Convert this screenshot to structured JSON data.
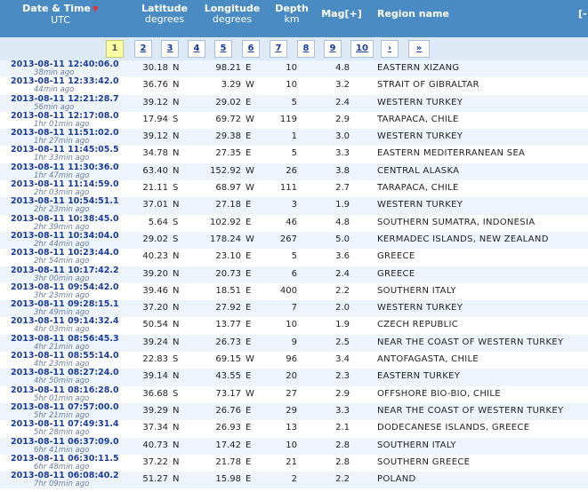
{
  "header": {
    "datetime_label": "Date & Time",
    "datetime_sub": "UTC",
    "sort_icon": "▼",
    "lat_label": "Latitude",
    "lat_sub": "degrees",
    "lon_label": "Longitude",
    "lon_sub": "degrees",
    "depth_label": "Depth",
    "depth_sub": "km",
    "mag_label": "Mag[+]",
    "region_label": "Region name",
    "extra_label": "[-"
  },
  "pagination": {
    "pages": [
      "1",
      "2",
      "3",
      "4",
      "5",
      "6",
      "7",
      "8",
      "9",
      "10",
      "›",
      "»"
    ],
    "current": "1"
  },
  "rows": [
    {
      "datetime": "2013-08-11 12:40:06.0",
      "ago": "38min ago",
      "lat": "30.18",
      "ns": "N",
      "lon": "98.21",
      "ew": "E",
      "depth": "10",
      "mag": "4.8",
      "region": "EASTERN XIZANG"
    },
    {
      "datetime": "2013-08-11 12:33:42.0",
      "ago": "44min ago",
      "lat": "36.76",
      "ns": "N",
      "lon": "3.29",
      "ew": "W",
      "depth": "10",
      "mag": "3.2",
      "region": "STRAIT OF GIBRALTAR"
    },
    {
      "datetime": "2013-08-11 12:21:28.7",
      "ago": "56min ago",
      "lat": "39.12",
      "ns": "N",
      "lon": "29.02",
      "ew": "E",
      "depth": "5",
      "mag": "2.4",
      "region": "WESTERN TURKEY"
    },
    {
      "datetime": "2013-08-11 12:17:08.0",
      "ago": "1hr 01min ago",
      "lat": "17.94",
      "ns": "S",
      "lon": "69.72",
      "ew": "W",
      "depth": "119",
      "mag": "2.9",
      "region": "TARAPACA, CHILE"
    },
    {
      "datetime": "2013-08-11 11:51:02.0",
      "ago": "1hr 27min ago",
      "lat": "39.12",
      "ns": "N",
      "lon": "29.38",
      "ew": "E",
      "depth": "1",
      "mag": "3.0",
      "region": "WESTERN TURKEY"
    },
    {
      "datetime": "2013-08-11 11:45:05.5",
      "ago": "1hr 33min ago",
      "lat": "34.78",
      "ns": "N",
      "lon": "27.35",
      "ew": "E",
      "depth": "5",
      "mag": "3.3",
      "region": "EASTERN MEDITERRANEAN SEA"
    },
    {
      "datetime": "2013-08-11 11:30:36.0",
      "ago": "1hr 47min ago",
      "lat": "63.40",
      "ns": "N",
      "lon": "152.92",
      "ew": "W",
      "depth": "26",
      "mag": "3.8",
      "region": "CENTRAL ALASKA"
    },
    {
      "datetime": "2013-08-11 11:14:59.0",
      "ago": "2hr 03min ago",
      "lat": "21.11",
      "ns": "S",
      "lon": "68.97",
      "ew": "W",
      "depth": "111",
      "mag": "2.7",
      "region": "TARAPACA, CHILE"
    },
    {
      "datetime": "2013-08-11 10:54:51.1",
      "ago": "2hr 23min ago",
      "lat": "37.01",
      "ns": "N",
      "lon": "27.18",
      "ew": "E",
      "depth": "3",
      "mag": "1.9",
      "region": "WESTERN TURKEY"
    },
    {
      "datetime": "2013-08-11 10:38:45.0",
      "ago": "2hr 39min ago",
      "lat": "5.64",
      "ns": "S",
      "lon": "102.92",
      "ew": "E",
      "depth": "46",
      "mag": "4.8",
      "region": "SOUTHERN SUMATRA, INDONESIA"
    },
    {
      "datetime": "2013-08-11 10:34:04.0",
      "ago": "2hr 44min ago",
      "lat": "29.02",
      "ns": "S",
      "lon": "178.24",
      "ew": "W",
      "depth": "267",
      "mag": "5.0",
      "region": "KERMADEC ISLANDS, NEW ZEALAND"
    },
    {
      "datetime": "2013-08-11 10:23:44.0",
      "ago": "2hr 54min ago",
      "lat": "40.23",
      "ns": "N",
      "lon": "23.10",
      "ew": "E",
      "depth": "5",
      "mag": "3.6",
      "region": "GREECE"
    },
    {
      "datetime": "2013-08-11 10:17:42.2",
      "ago": "3hr 00min ago",
      "lat": "39.20",
      "ns": "N",
      "lon": "20.73",
      "ew": "E",
      "depth": "6",
      "mag": "2.4",
      "region": "GREECE"
    },
    {
      "datetime": "2013-08-11 09:54:42.0",
      "ago": "3hr 23min ago",
      "lat": "39.46",
      "ns": "N",
      "lon": "18.51",
      "ew": "E",
      "depth": "400",
      "mag": "2.2",
      "region": "SOUTHERN ITALY"
    },
    {
      "datetime": "2013-08-11 09:28:15.1",
      "ago": "3hr 49min ago",
      "lat": "37.20",
      "ns": "N",
      "lon": "27.92",
      "ew": "E",
      "depth": "7",
      "mag": "2.0",
      "region": "WESTERN TURKEY"
    },
    {
      "datetime": "2013-08-11 09:14:32.4",
      "ago": "4hr 03min ago",
      "lat": "50.54",
      "ns": "N",
      "lon": "13.77",
      "ew": "E",
      "depth": "10",
      "mag": "1.9",
      "region": "CZECH REPUBLIC"
    },
    {
      "datetime": "2013-08-11 08:56:45.3",
      "ago": "4hr 21min ago",
      "lat": "39.24",
      "ns": "N",
      "lon": "26.73",
      "ew": "E",
      "depth": "9",
      "mag": "2.5",
      "region": "NEAR THE COAST OF WESTERN TURKEY"
    },
    {
      "datetime": "2013-08-11 08:55:14.0",
      "ago": "4hr 23min ago",
      "lat": "22.83",
      "ns": "S",
      "lon": "69.15",
      "ew": "W",
      "depth": "96",
      "mag": "3.4",
      "region": "ANTOFAGASTA, CHILE"
    },
    {
      "datetime": "2013-08-11 08:27:24.0",
      "ago": "4hr 50min ago",
      "lat": "39.14",
      "ns": "N",
      "lon": "43.55",
      "ew": "E",
      "depth": "20",
      "mag": "2.3",
      "region": "EASTERN TURKEY"
    },
    {
      "datetime": "2013-08-11 08:16:28.0",
      "ago": "5hr 01min ago",
      "lat": "36.68",
      "ns": "S",
      "lon": "73.17",
      "ew": "W",
      "depth": "27",
      "mag": "2.9",
      "region": "OFFSHORE BIO-BIO, CHILE"
    },
    {
      "datetime": "2013-08-11 07:57:00.0",
      "ago": "5hr 21min ago",
      "lat": "39.29",
      "ns": "N",
      "lon": "26.76",
      "ew": "E",
      "depth": "29",
      "mag": "3.3",
      "region": "NEAR THE COAST OF WESTERN TURKEY"
    },
    {
      "datetime": "2013-08-11 07:49:31.4",
      "ago": "5hr 28min ago",
      "lat": "37.34",
      "ns": "N",
      "lon": "26.93",
      "ew": "E",
      "depth": "13",
      "mag": "2.1",
      "region": "DODECANESE ISLANDS, GREECE"
    },
    {
      "datetime": "2013-08-11 06:37:09.0",
      "ago": "6hr 41min ago",
      "lat": "40.73",
      "ns": "N",
      "lon": "17.42",
      "ew": "E",
      "depth": "10",
      "mag": "2.8",
      "region": "SOUTHERN ITALY"
    },
    {
      "datetime": "2013-08-11 06:30:11.5",
      "ago": "6hr 48min ago",
      "lat": "37.22",
      "ns": "N",
      "lon": "21.78",
      "ew": "E",
      "depth": "21",
      "mag": "2.8",
      "region": "SOUTHERN GREECE"
    },
    {
      "datetime": "2013-08-11 06:08:40.2",
      "ago": "7hr 09min ago",
      "lat": "51.27",
      "ns": "N",
      "lon": "15.98",
      "ew": "E",
      "depth": "2",
      "mag": "2.2",
      "region": "POLAND"
    }
  ]
}
